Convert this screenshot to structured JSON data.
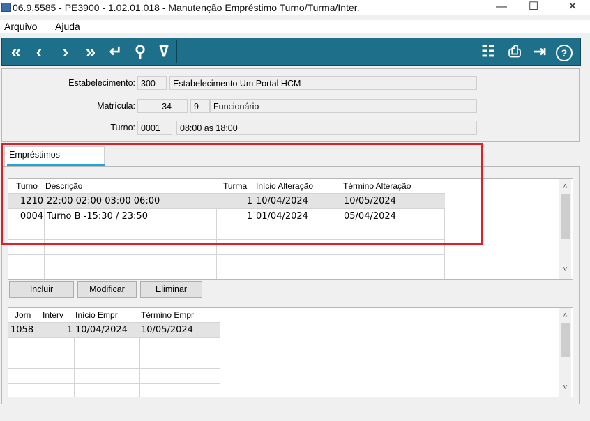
{
  "window": {
    "title": "06.9.5585 - PE3900 - 1.02.01.018 - Manutenção Empréstimo Turno/Turma/Inter.",
    "minimize": "—",
    "maximize": "☐",
    "close": "✕"
  },
  "menu": {
    "items": [
      "Arquivo",
      "Ajuda"
    ]
  },
  "toolbar": {
    "first": "«",
    "prev": "‹",
    "next": "›",
    "last": "»",
    "goto": "↵",
    "search": "⚲",
    "filter": "⊽",
    "tree": "☷",
    "print": "⎙",
    "exit": "⇥",
    "help": "?"
  },
  "header": {
    "estabelecimento": {
      "label": "Estabelecimento:",
      "code": "300",
      "name": "Estabelecimento Um Portal HCM"
    },
    "matricula": {
      "label": "Matrícula:",
      "number": "34",
      "digit": "9",
      "name": "Funcionário"
    },
    "turno": {
      "label": "Turno:",
      "code": "0001",
      "description": "08:00 as 18:00"
    }
  },
  "tabs": [
    {
      "label": "Empréstimos",
      "active": true
    }
  ],
  "grid1": {
    "headers": [
      "Turno",
      "Descrição",
      "Turma",
      "Início Alteração",
      "Término Alteração"
    ],
    "rows": [
      {
        "turno": "1210",
        "descricao": "22:00 02:00 03:00 06:00",
        "turma": "1",
        "inicio": "10/04/2024",
        "termino": "10/05/2024"
      },
      {
        "turno": "0004",
        "descricao": "Turno B -15:30 / 23:50",
        "turma": "1",
        "inicio": "01/04/2024",
        "termino": "05/04/2024"
      }
    ]
  },
  "buttons": {
    "incluir": "Incluir",
    "modificar": "Modificar",
    "eliminar": "Eliminar"
  },
  "grid2": {
    "headers": [
      "Jorn",
      "Interv",
      "Início Empr",
      "Término Empr"
    ],
    "rows": [
      {
        "jorn": "1058",
        "interv": "1",
        "inicio": "10/04/2024",
        "termino": "10/05/2024"
      }
    ]
  },
  "scroll": {
    "up": "˄",
    "down": "˅"
  },
  "colors": {
    "toolbar": "#1d6f8a",
    "highlight": "#e01e26",
    "tab_underline": "#1fa7d8"
  }
}
